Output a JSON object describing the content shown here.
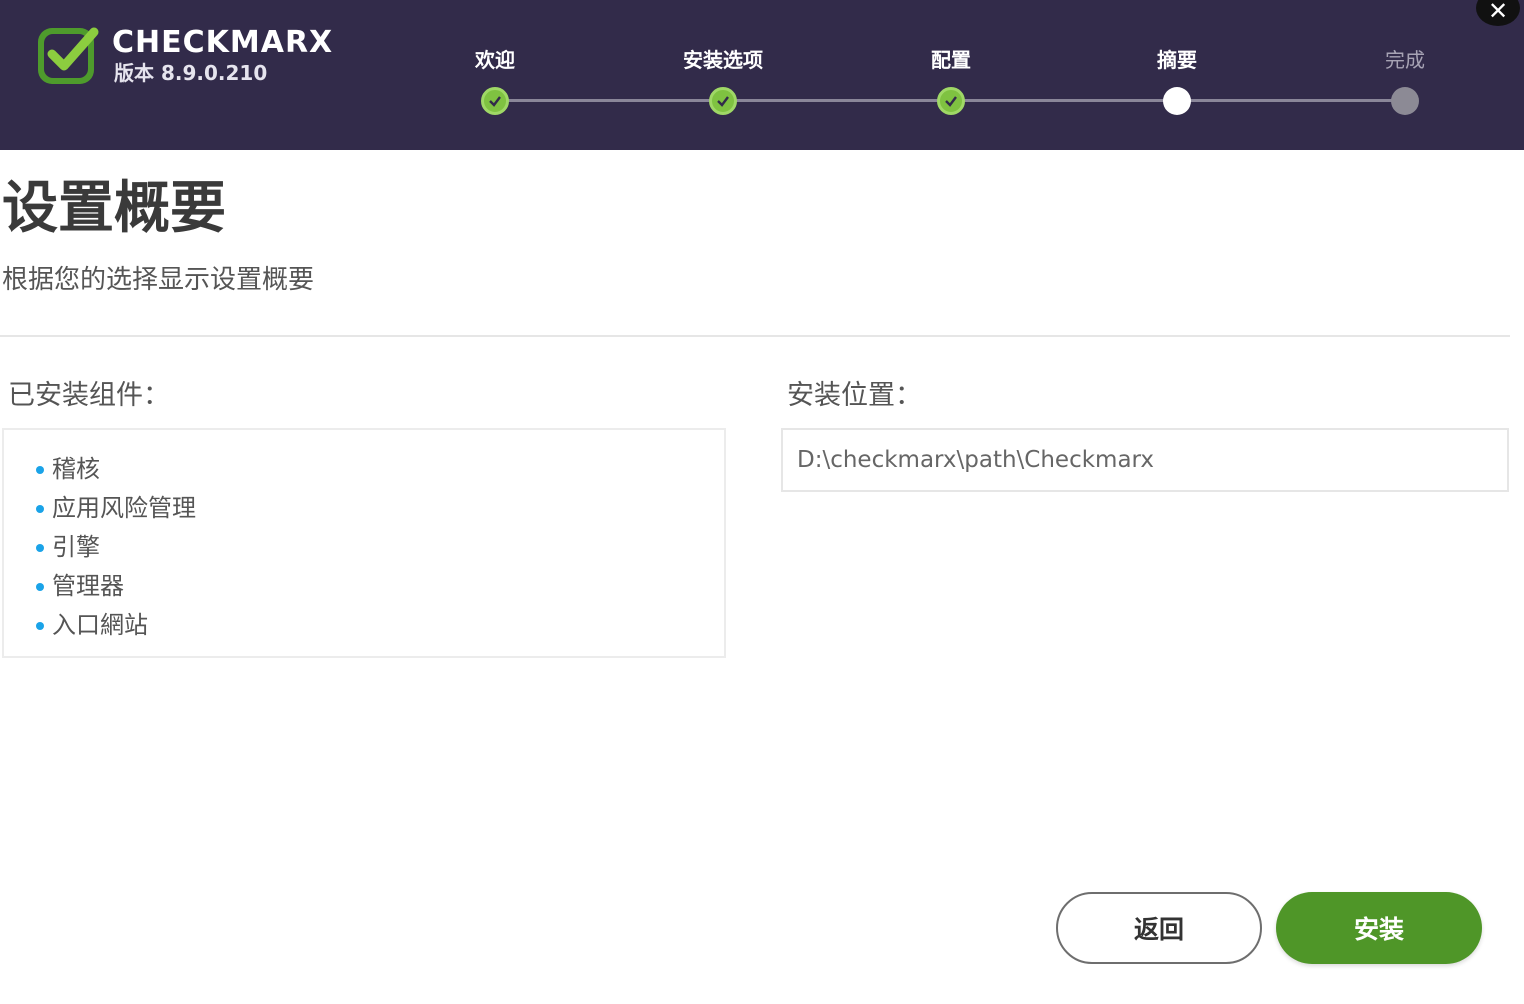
{
  "header": {
    "brand": "CHECKMARX",
    "version": "版本 8.9.0.210",
    "close_glyph": "✕",
    "steps": [
      {
        "label": "欢迎",
        "state": "done"
      },
      {
        "label": "安装选项",
        "state": "done"
      },
      {
        "label": "配置",
        "state": "done"
      },
      {
        "label": "摘要",
        "state": "current"
      },
      {
        "label": "完成",
        "state": "pending"
      }
    ]
  },
  "main": {
    "title": "设置概要",
    "subtitle": "根据您的选择显示设置概要",
    "installed_label": "已安装组件：",
    "components": [
      "稽核",
      "应用风险管理",
      "引擎",
      "管理器",
      "入口網站"
    ],
    "location_label": "安装位置：",
    "location_value": "D:\\checkmarx\\path\\Checkmarx"
  },
  "footer": {
    "back_label": "返回",
    "install_label": "安装"
  },
  "colors": {
    "header_bg": "#322b4a",
    "done_step": "#7fc241",
    "install_button": "#4f9628",
    "bullet": "#1aa3e8"
  }
}
